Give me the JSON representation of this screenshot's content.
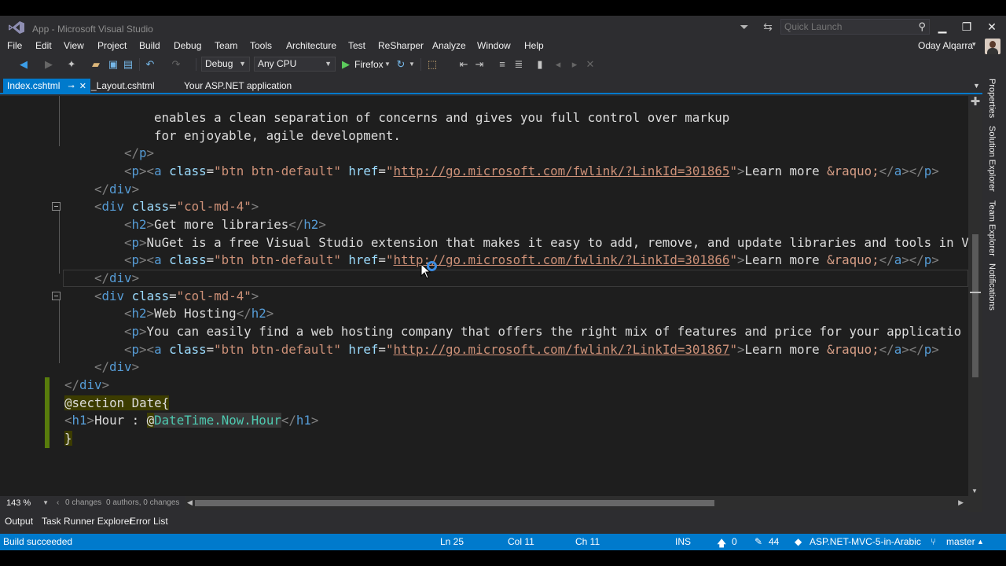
{
  "window": {
    "title": "App - Microsoft Visual Studio",
    "quick_launch_placeholder": "Quick Launch",
    "user_name": "Oday Alqarra"
  },
  "menu": [
    "File",
    "Edit",
    "View",
    "Project",
    "Build",
    "Debug",
    "Team",
    "Tools",
    "Architecture",
    "Test",
    "ReSharper",
    "Analyze",
    "Window",
    "Help"
  ],
  "toolbar": {
    "configuration": "Debug",
    "platform": "Any CPU",
    "run_target": "Firefox"
  },
  "tabs": [
    {
      "label": "Index.cshtml",
      "active": true
    },
    {
      "label": "_Layout.cshtml",
      "active": false
    },
    {
      "label": "Your ASP.NET application",
      "active": false
    }
  ],
  "editor": {
    "zoom": "143 %",
    "changes": "0 changes",
    "authors": "0 authors, 0 changes",
    "code": {
      "l1": "enables a clean separation of concerns and gives you full control over markup",
      "l2": "for enjoyable, agile development.",
      "l4_link": "http://go.microsoft.com/fwlink/?LinkId=301865",
      "l8_text": "NuGet is a free Visual Studio extension that makes it easy to add, remove, and update libraries and tools in V",
      "l9_link": "http://go.microsoft.com/fwlink/?LinkId=301866",
      "l12_heading": "Web Hosting",
      "l13_text": "You can easily find a web hosting company that offers the right mix of features and price for your applicatio",
      "l14_link": "http://go.microsoft.com/fwlink/?LinkId=301867",
      "l7_heading": "Get more libraries",
      "learn_more": "Learn more ",
      "raquo": "&raquo;",
      "section_line": "@section Date{",
      "h1_text": "Hour : ",
      "razor_expr": "DateTime.Now.Hour"
    }
  },
  "side_tabs": [
    "Properties",
    "Solution Explorer",
    "Team Explorer",
    "Notifications"
  ],
  "output_tabs": [
    "Output",
    "Task Runner Explorer",
    "Error List"
  ],
  "status": {
    "message": "Build succeeded",
    "ln": "Ln 25",
    "col": "Col 11",
    "ch": "Ch 11",
    "mode": "INS",
    "up_count": "0",
    "pencil_count": "44",
    "repo": "ASP.NET-MVC-5-in-Arabic",
    "branch": "master"
  },
  "colors": {
    "accent": "#007acc",
    "chrome": "#2d2d30",
    "editor_bg": "#1e1e1e"
  }
}
